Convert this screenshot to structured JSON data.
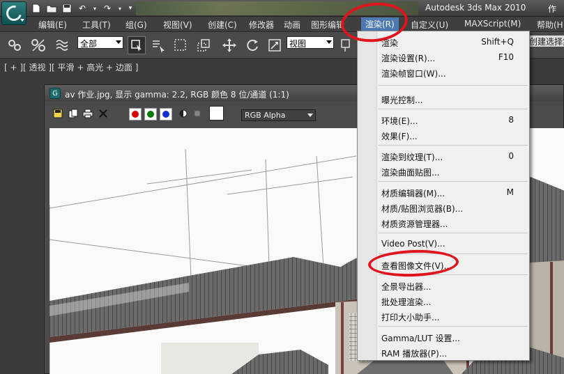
{
  "titlebar": {
    "app_title": "Autodesk 3ds Max  2010",
    "doc_title": "作业"
  },
  "menubar": {
    "items": [
      {
        "label": "编辑(E)"
      },
      {
        "label": "工具(T)"
      },
      {
        "label": "组(G)"
      },
      {
        "label": "视图(V)"
      },
      {
        "label": "创建(C)"
      },
      {
        "label": "修改器"
      },
      {
        "label": "动画"
      },
      {
        "label": "图形编辑"
      },
      {
        "label": "渲染(R)"
      },
      {
        "label": "自定义(U)"
      },
      {
        "label": "MAXScript(M)"
      },
      {
        "label": "帮助(H)"
      }
    ]
  },
  "toolbar": {
    "selection_filter": "全部",
    "view_dropdown": "视图",
    "right_field": "创建选择集"
  },
  "viewport": {
    "label": "[ + ][ 透视 ][ 平滑 + 高光 + 边面 ]"
  },
  "image_window": {
    "title": "av 作业.jpg, 显示 gamma: 2.2, RGB 颜色 8 位/通道 (1:1)",
    "channel_dropdown": "RGB Alpha"
  },
  "render_menu": {
    "items": [
      {
        "label": "渲染",
        "shortcut": "Shift+Q"
      },
      {
        "label": "渲染设置(R)...",
        "shortcut": "F10"
      },
      {
        "label": "渲染帧窗口(W)...",
        "shortcut": ""
      },
      {
        "label": "曝光控制...",
        "shortcut": ""
      },
      {
        "label": "环境(E)...",
        "shortcut": "8"
      },
      {
        "label": "效果(F)...",
        "shortcut": ""
      },
      {
        "label": "渲染到纹理(T)...",
        "shortcut": "0"
      },
      {
        "label": "渲染曲面贴图...",
        "shortcut": ""
      },
      {
        "label": "材质编辑器(M)...",
        "shortcut": "M"
      },
      {
        "label": "材质/贴图浏览器(B)...",
        "shortcut": ""
      },
      {
        "label": "材质资源管理器...",
        "shortcut": ""
      },
      {
        "label": "Video Post(V)...",
        "shortcut": ""
      },
      {
        "label": "查看图像文件(V)...",
        "shortcut": ""
      },
      {
        "label": "全景导出器...",
        "shortcut": ""
      },
      {
        "label": "批处理渲染...",
        "shortcut": ""
      },
      {
        "label": "打印大小助手...",
        "shortcut": ""
      },
      {
        "label": "Gamma/LUT 设置...",
        "shortcut": ""
      },
      {
        "label": "RAM 播放器(P)...",
        "shortcut": ""
      }
    ]
  },
  "colors": {
    "annotation_red": "#e0141c",
    "menu_highlight": "#4b79b0",
    "menu_bg": "#f0f0f0"
  }
}
